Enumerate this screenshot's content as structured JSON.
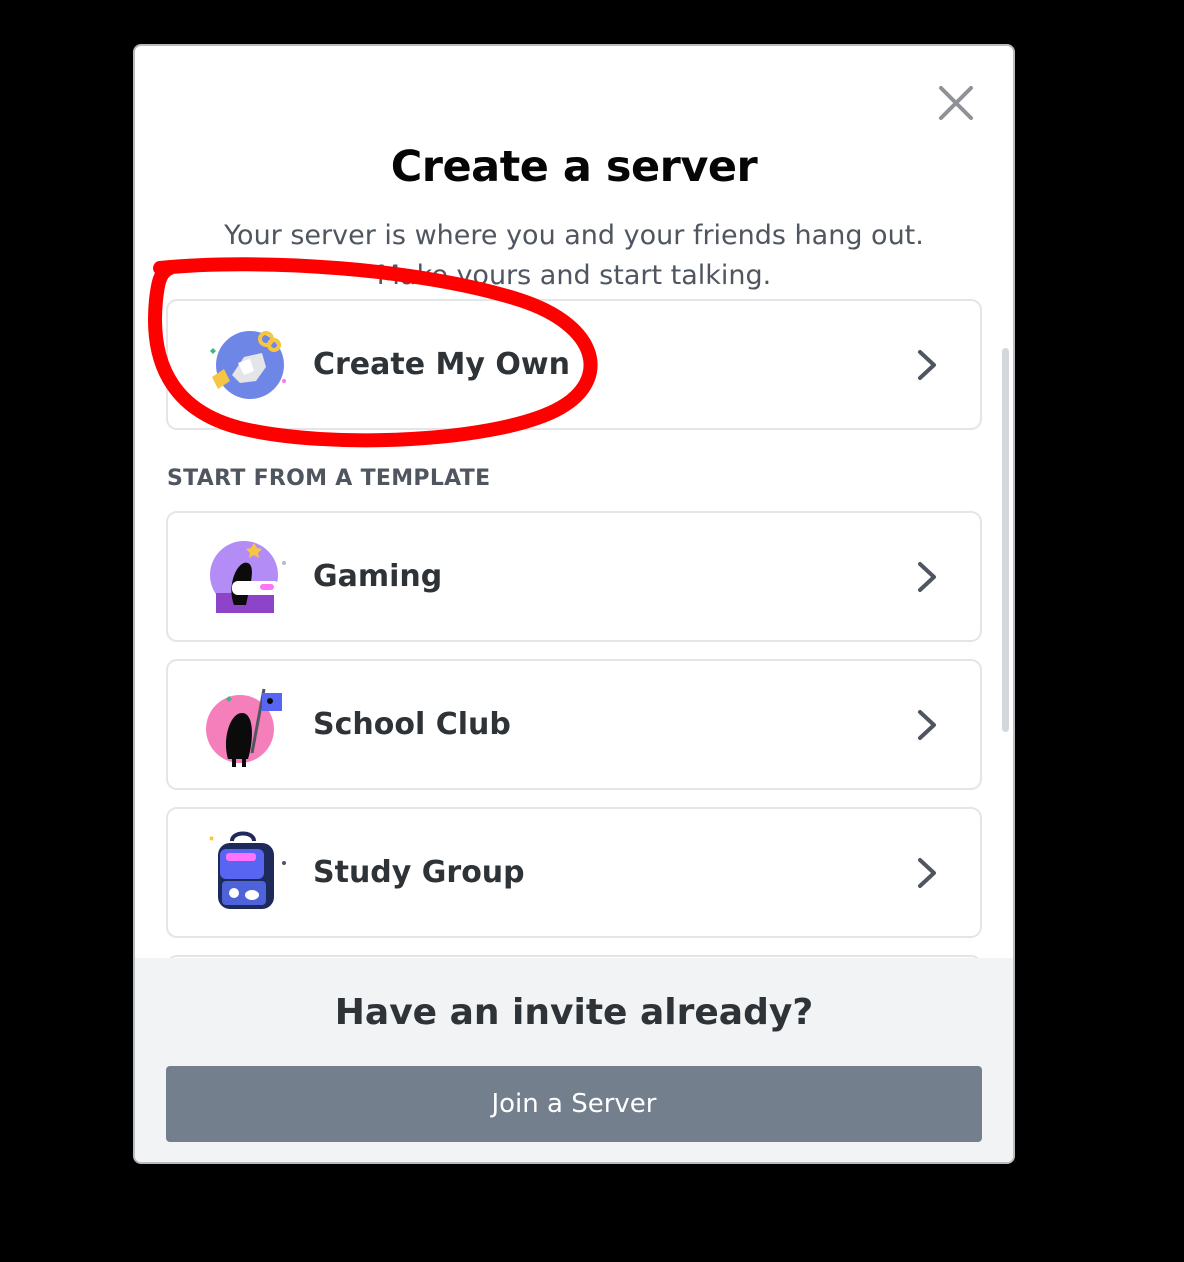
{
  "modal": {
    "title": "Create a server",
    "subtitle": "Your server is where you and your friends hang out. Make yours and start talking."
  },
  "create_own": {
    "label": "Create My Own",
    "icon": "create-own-illustration-icon"
  },
  "templates": {
    "section_label": "START FROM A TEMPLATE",
    "items": [
      {
        "label": "Gaming",
        "icon": "gaming-illustration-icon"
      },
      {
        "label": "School Club",
        "icon": "school-club-illustration-icon"
      },
      {
        "label": "Study Group",
        "icon": "study-group-illustration-icon"
      }
    ]
  },
  "footer": {
    "heading": "Have an invite already?",
    "join_label": "Join a Server"
  },
  "colors": {
    "join_button": "#747f8d",
    "annotation": "#ff0000",
    "footer_bg": "#f2f3f5"
  }
}
